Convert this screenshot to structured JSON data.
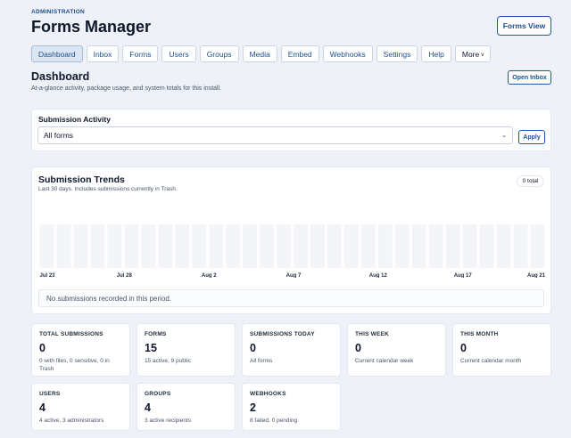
{
  "header": {
    "eyebrow": "ADMINISTRATION",
    "title": "Forms Manager",
    "forms_view_label": "Forms View"
  },
  "tabs": [
    {
      "label": "Dashboard",
      "active": true
    },
    {
      "label": "Inbox"
    },
    {
      "label": "Forms"
    },
    {
      "label": "Users"
    },
    {
      "label": "Groups"
    },
    {
      "label": "Media"
    },
    {
      "label": "Embed"
    },
    {
      "label": "Webhooks"
    },
    {
      "label": "Settings"
    },
    {
      "label": "Help"
    },
    {
      "label": "More"
    }
  ],
  "page": {
    "title": "Dashboard",
    "subtitle": "At-a-glance activity, package usage, and system totals for this install.",
    "open_inbox_label": "Open Inbox"
  },
  "activity": {
    "title": "Submission Activity",
    "selected_form": "All forms",
    "apply_label": "Apply"
  },
  "trends": {
    "title": "Submission Trends",
    "subtitle": "Last 30 days. Includes submissions currently in Trash.",
    "total_label": "0 total",
    "empty_message": "No submissions recorded in this period."
  },
  "chart_data": {
    "type": "bar",
    "title": "Submission Trends",
    "days": 30,
    "values": [
      0,
      0,
      0,
      0,
      0,
      0,
      0,
      0,
      0,
      0,
      0,
      0,
      0,
      0,
      0,
      0,
      0,
      0,
      0,
      0,
      0,
      0,
      0,
      0,
      0,
      0,
      0,
      0,
      0,
      0
    ],
    "tick_labels": [
      "Jul 23",
      "Jul 28",
      "Aug 2",
      "Aug 7",
      "Aug 12",
      "Aug 17",
      "Aug 21"
    ],
    "tick_indices": [
      0,
      5,
      10,
      15,
      20,
      25,
      29
    ],
    "grid": false
  },
  "stats": [
    {
      "label": "TOTAL SUBMISSIONS",
      "value": "0",
      "detail": "0 with files, 0 sensitive, 0 in Trash"
    },
    {
      "label": "FORMS",
      "value": "15",
      "detail": "15 active, 9 public"
    },
    {
      "label": "SUBMISSIONS TODAY",
      "value": "0",
      "detail": "All forms"
    },
    {
      "label": "THIS WEEK",
      "value": "0",
      "detail": "Current calendar week"
    },
    {
      "label": "THIS MONTH",
      "value": "0",
      "detail": "Current calendar month"
    },
    {
      "label": "USERS",
      "value": "4",
      "detail": "4 active, 3 administrators"
    },
    {
      "label": "GROUPS",
      "value": "4",
      "detail": "3 active recipients"
    },
    {
      "label": "WEBHOOKS",
      "value": "2",
      "detail": "8 failed, 0 pending"
    }
  ],
  "colors": {
    "accent": "#1e5aa8",
    "background": "#eef2f8",
    "bar_placeholder": "#f3f5f8"
  }
}
